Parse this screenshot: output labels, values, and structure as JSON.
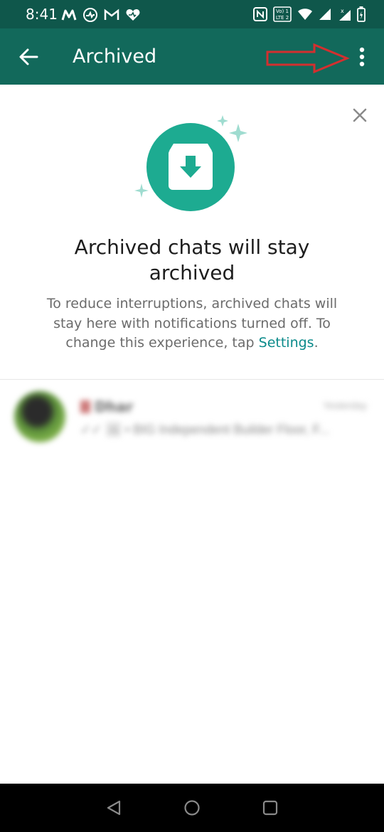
{
  "status_bar": {
    "time": "8:41",
    "left_icons": [
      "myntra-icon",
      "activity-icon",
      "gmail-icon",
      "heart-icon"
    ],
    "right_icons": [
      "nfc-icon",
      "volte-icon",
      "wifi-icon",
      "signal-icon",
      "signal-icon-2",
      "battery-icon"
    ],
    "volte_text": "Vo) 1\nLTE 2"
  },
  "app_bar": {
    "title": "Archived",
    "color": "#12695b"
  },
  "banner": {
    "title": "Archived chats will stay archived",
    "body_prefix": "To reduce interruptions, archived chats will stay here with notifications turned off. To change this experience, tap ",
    "settings_link": "Settings",
    "body_suffix": ".",
    "accent_color": "#1dab91"
  },
  "chats": [
    {
      "name": "Dhar",
      "time": "Yesterday",
      "preview": "✓✓ 🖼 • BIG Independent Builder Floor, F..."
    }
  ],
  "annotation": {
    "color": "#d32f2f"
  }
}
